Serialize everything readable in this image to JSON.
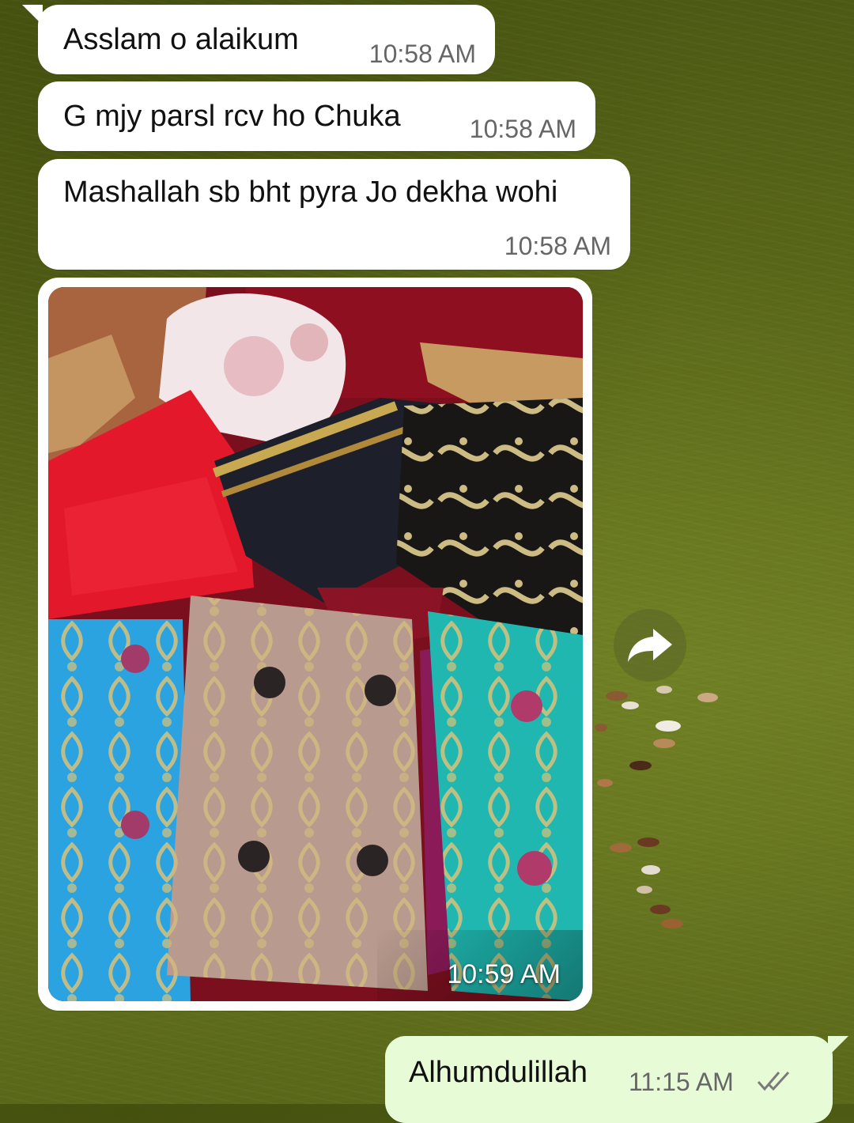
{
  "messages": [
    {
      "direction": "incoming",
      "text": "Asslam o alaikum",
      "time": "10:58 AM"
    },
    {
      "direction": "incoming",
      "text": "G mjy parsl rcv ho Chuka",
      "time": "10:58 AM"
    },
    {
      "direction": "incoming",
      "text": "Mashallah sb bht pyra Jo dekha wohi",
      "time": "10:58 AM"
    },
    {
      "direction": "incoming",
      "type": "image",
      "time": "10:59 AM"
    },
    {
      "direction": "outgoing",
      "text": "Alhumdulillah",
      "time": "11:15 AM",
      "status": "read"
    }
  ],
  "icons": {
    "forward": "forward-arrow-icon",
    "read_receipt": "double-check-icon"
  },
  "colors": {
    "incoming_bubble": "#ffffff",
    "outgoing_bubble": "#e8fbd7",
    "timestamp": "#666666",
    "wallpaper": "#5e6c1b"
  }
}
